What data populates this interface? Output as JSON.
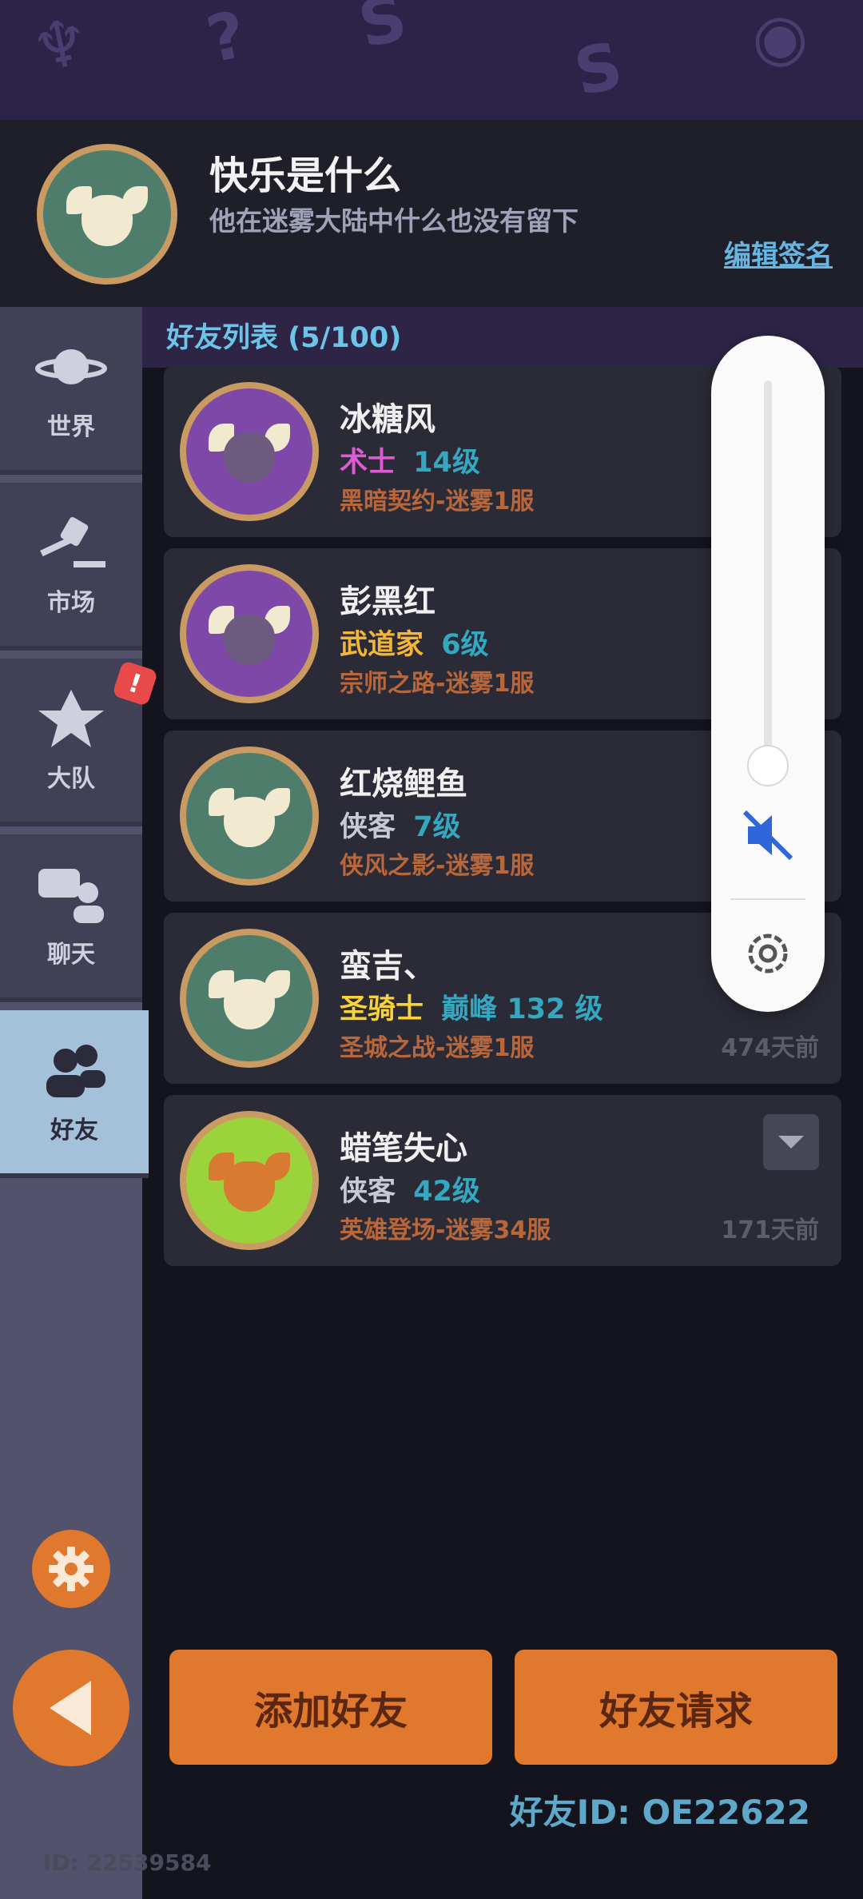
{
  "profile": {
    "name": "快乐是什么",
    "signature": "他在迷雾大陆中什么也没有留下",
    "edit_label": "编辑签名"
  },
  "sidebar": {
    "items": [
      {
        "label": "世界",
        "icon": "planet-icon"
      },
      {
        "label": "市场",
        "icon": "gavel-icon"
      },
      {
        "label": "大队",
        "icon": "guild-icon"
      },
      {
        "label": "聊天",
        "icon": "chat-icon"
      },
      {
        "label": "好友",
        "icon": "friends-icon",
        "active": true
      }
    ],
    "badge": "!"
  },
  "friends": {
    "title": "好友列表 (5/100)",
    "list": [
      {
        "name": "冰糖风",
        "class": "术士",
        "class_color": "#e05ad6",
        "level": "14级",
        "server": "黑暗契约-迷雾1服",
        "time": "",
        "avatar": "purple"
      },
      {
        "name": "彭黑红",
        "class": "武道家",
        "class_color": "#f2b63c",
        "level": "6级",
        "server": "宗师之路-迷雾1服",
        "time": "",
        "avatar": "purple"
      },
      {
        "name": "红烧鲤鱼",
        "class": "侠客",
        "class_color": "#c9c9d4",
        "level": "7级",
        "server": "侠风之影-迷雾1服",
        "time": "",
        "avatar": "teal"
      },
      {
        "name": "蛮吉、",
        "class": "圣骑士",
        "class_color": "#f7d23a",
        "level": "巅峰 132 级",
        "server": "圣城之战-迷雾1服",
        "time": "474天前",
        "avatar": "teal"
      },
      {
        "name": "蜡笔失心",
        "class": "侠客",
        "class_color": "#c9c9d4",
        "level": "42级",
        "server": "英雄登场-迷雾34服",
        "time": "171天前",
        "avatar": "green"
      }
    ]
  },
  "actions": {
    "add_friend": "添加好友",
    "friend_requests": "好友请求"
  },
  "friend_id": "好友ID: OE22622",
  "user_id": "ID: 22539584",
  "colors": {
    "accent": "#e0782e",
    "level": "#35a7c0",
    "server": "#b9663a"
  }
}
